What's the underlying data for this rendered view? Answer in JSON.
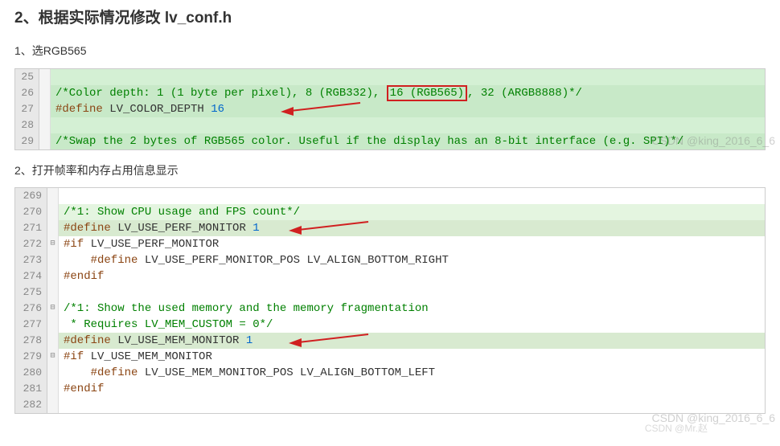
{
  "heading": "2、根据实际情况修改  lv_conf.h",
  "sub1": "1、选RGB565",
  "sub2": "2、打开帧率和内存占用信息显示",
  "block1": {
    "lines": [
      {
        "num": "25",
        "cls": "bg-green-alt",
        "segs": []
      },
      {
        "num": "26",
        "cls": "bg-green",
        "segs": [
          {
            "t": "/*Color depth: 1 (1 byte per pixel), 8 (RGB332), ",
            "c": "c-comment"
          },
          {
            "t": "16 (RGB565)",
            "c": "c-comment",
            "box": true
          },
          {
            "t": ", 32 (ARGB8888)*/",
            "c": "c-comment"
          }
        ]
      },
      {
        "num": "27",
        "cls": "bg-green",
        "segs": [
          {
            "t": "#define",
            "c": "c-pp"
          },
          {
            "t": " LV_COLOR_DEPTH ",
            "c": "c-ident"
          },
          {
            "t": "16",
            "c": "c-num"
          }
        ],
        "arrow": true
      },
      {
        "num": "28",
        "cls": "bg-green-alt",
        "segs": []
      },
      {
        "num": "29",
        "cls": "bg-green",
        "segs": [
          {
            "t": "/*Swap the 2 bytes of RGB565 color. Useful if the display has an 8-bit interface (e.g. SPI)*/",
            "c": "c-comment"
          }
        ]
      }
    ]
  },
  "block2": {
    "lines": [
      {
        "num": "269",
        "cls": "",
        "segs": []
      },
      {
        "num": "270",
        "cls": "bg-lime",
        "segs": [
          {
            "t": "/*1: Show CPU usage and FPS count*/",
            "c": "c-comment"
          }
        ]
      },
      {
        "num": "271",
        "cls": "bg-hl",
        "segs": [
          {
            "t": "#define",
            "c": "c-pp"
          },
          {
            "t": " LV_USE_PERF_MONITOR ",
            "c": "c-ident"
          },
          {
            "t": "1",
            "c": "c-num"
          }
        ],
        "arrow": true
      },
      {
        "num": "272",
        "cls": "",
        "fold": "⊟",
        "segs": [
          {
            "t": "#if",
            "c": "c-pp"
          },
          {
            "t": " LV_USE_PERF_MONITOR",
            "c": "c-ident"
          }
        ]
      },
      {
        "num": "273",
        "cls": "",
        "segs": [
          {
            "t": "    #define",
            "c": "c-pp"
          },
          {
            "t": " LV_USE_PERF_MONITOR_POS LV_ALIGN_BOTTOM_RIGHT",
            "c": "c-ident"
          }
        ]
      },
      {
        "num": "274",
        "cls": "",
        "segs": [
          {
            "t": "#endif",
            "c": "c-pp"
          }
        ]
      },
      {
        "num": "275",
        "cls": "",
        "segs": []
      },
      {
        "num": "276",
        "cls": "",
        "fold": "⊟",
        "segs": [
          {
            "t": "/*1: Show the used memory and the memory fragmentation",
            "c": "c-comment"
          }
        ]
      },
      {
        "num": "277",
        "cls": "",
        "segs": [
          {
            "t": " * Requires LV_MEM_CUSTOM = 0*/",
            "c": "c-comment"
          }
        ]
      },
      {
        "num": "278",
        "cls": "bg-hl",
        "segs": [
          {
            "t": "#define",
            "c": "c-pp"
          },
          {
            "t": " LV_USE_MEM_MONITOR ",
            "c": "c-ident"
          },
          {
            "t": "1",
            "c": "c-num"
          }
        ],
        "arrow": true
      },
      {
        "num": "279",
        "cls": "",
        "fold": "⊟",
        "segs": [
          {
            "t": "#if",
            "c": "c-pp"
          },
          {
            "t": " LV_USE_MEM_MONITOR",
            "c": "c-ident"
          }
        ]
      },
      {
        "num": "280",
        "cls": "",
        "segs": [
          {
            "t": "    #define",
            "c": "c-pp"
          },
          {
            "t": " LV_USE_MEM_MONITOR_POS LV_ALIGN_BOTTOM_LEFT",
            "c": "c-ident"
          }
        ]
      },
      {
        "num": "281",
        "cls": "",
        "segs": [
          {
            "t": "#endif",
            "c": "c-pp"
          }
        ]
      },
      {
        "num": "282",
        "cls": "",
        "segs": []
      }
    ]
  },
  "watermarks": {
    "a": "CSDN @king_2016_6_6",
    "b": "CSDN @king_2016_6_6",
    "c": "CSDN @Mr.赵"
  }
}
